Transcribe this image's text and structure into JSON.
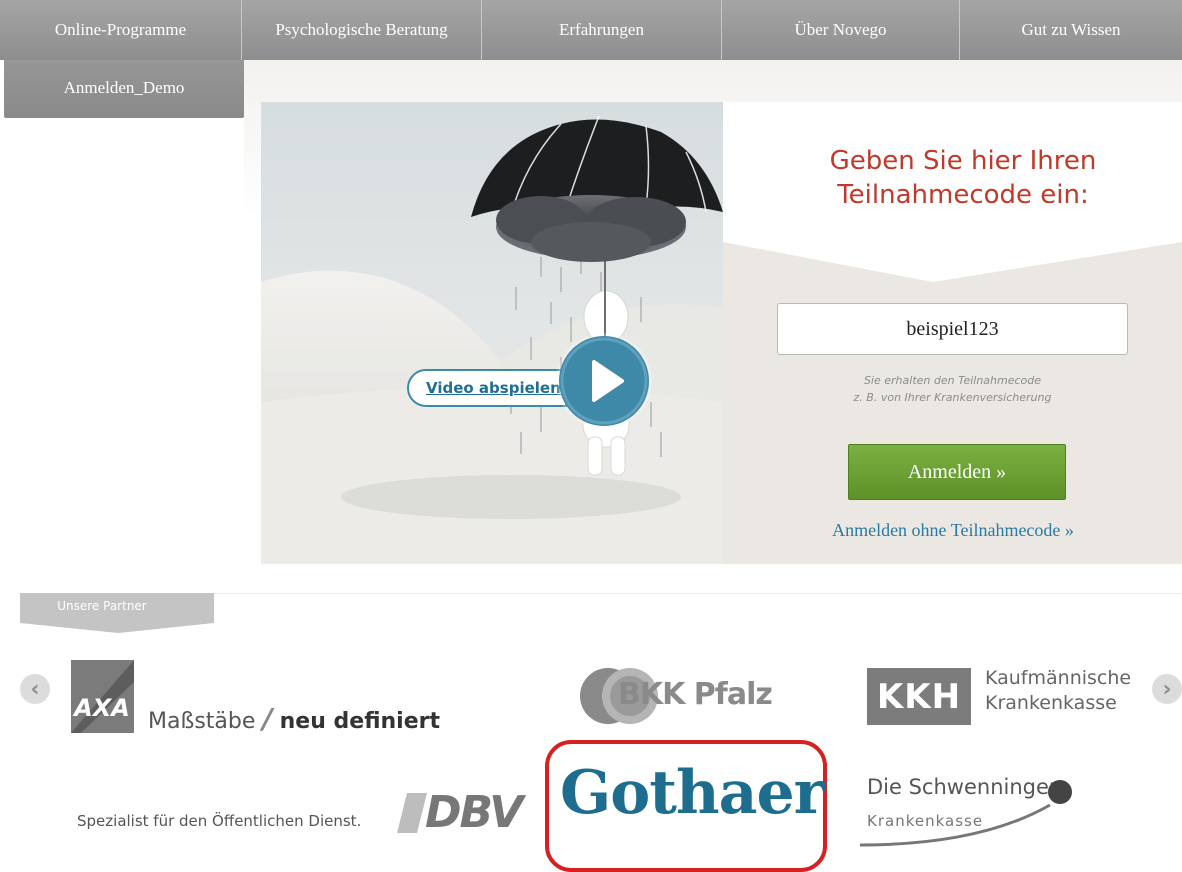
{
  "nav": {
    "items": [
      {
        "label": "Online-Programme"
      },
      {
        "label": "Psychologische Beratung"
      },
      {
        "label": "Erfahrungen"
      },
      {
        "label": "Über Novego"
      },
      {
        "label": "Gut zu Wissen"
      }
    ],
    "sub_item": "Anmelden_Demo"
  },
  "video": {
    "label": "Video abspielen"
  },
  "login": {
    "title": "Geben Sie hier Ihren Teilnahmecode ein:",
    "code_value": "beispiel123",
    "hint_line1": "Sie erhalten den Teilnahmecode",
    "hint_line2": "z. B. von Ihrer Krankenversicherung",
    "submit_label": "Anmelden »",
    "alt_link": "Anmelden ohne Teilnahmecode »",
    "title_color": "#c0392b",
    "button_color": "#6ea336"
  },
  "partners": {
    "heading": "Unsere Partner",
    "prev": "‹",
    "next": "›",
    "axa": {
      "logo": "AXA",
      "tagline_a": "Maßstäbe",
      "tagline_sep": "/",
      "tagline_b": "neu definiert"
    },
    "bkk": {
      "name": "BKK Pfalz"
    },
    "kkh": {
      "logo": "KKH",
      "line1": "Kaufmännische",
      "line2": "Krankenkasse"
    },
    "dbv": {
      "tagline": "Spezialist für den Öffentlichen Dienst.",
      "logo": "DBV"
    },
    "gothaer": {
      "name": "Gothaer",
      "highlight_color": "#d62121"
    },
    "schwenninger": {
      "line1": "Die Schwenninger",
      "line2": "Krankenkasse"
    }
  }
}
